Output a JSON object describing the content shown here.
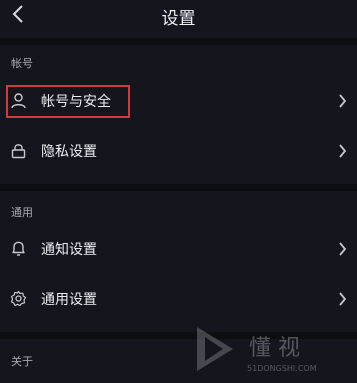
{
  "header": {
    "title": "设置"
  },
  "sections": {
    "account": "帐号",
    "general": "通用",
    "about": "关于"
  },
  "rows": {
    "account_security": "帐号与安全",
    "privacy": "隐私设置",
    "notifications": "通知设置",
    "general_settings": "通用设置"
  },
  "watermark": {
    "logo_text": "懂 视",
    "url_text": "51DONGSHI.COM"
  },
  "colors": {
    "background": "#15161d",
    "section_divider": "#0d0e12",
    "highlight_box": "#d7393a",
    "text": "#ececf0",
    "muted": "#a8a9b0"
  },
  "icons": {
    "back": "chevron-left-icon",
    "account_security": "user-icon",
    "privacy": "lock-icon",
    "notifications": "bell-icon",
    "general_settings": "gear-icon",
    "row_arrow": "chevron-right-icon"
  }
}
